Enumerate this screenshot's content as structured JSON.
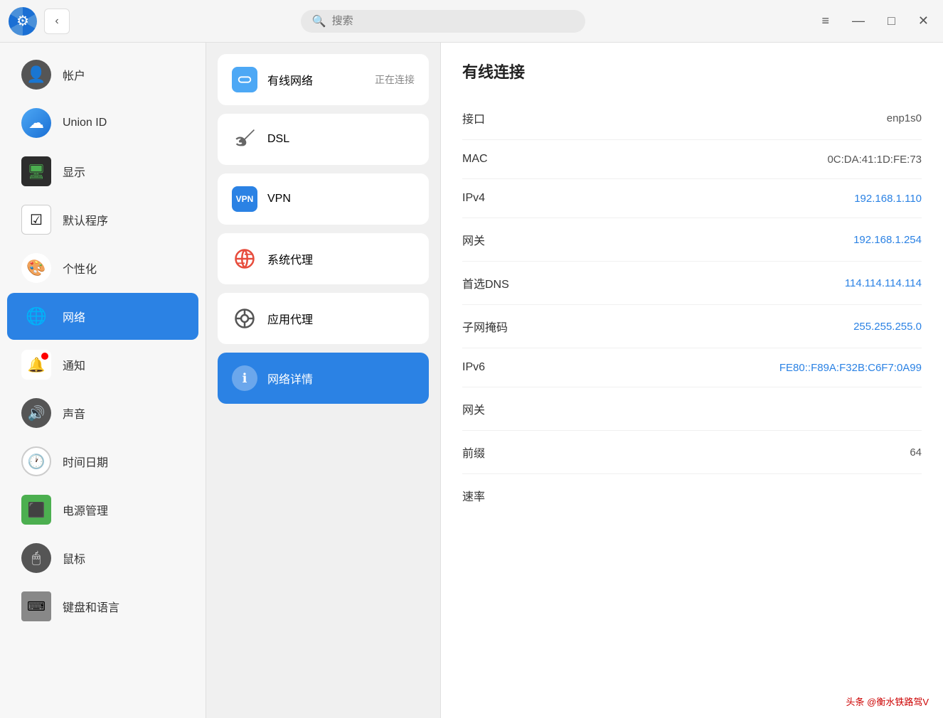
{
  "titlebar": {
    "back_label": "‹",
    "search_placeholder": "搜索",
    "menu_icon": "≡",
    "minimize_icon": "—",
    "restore_icon": "□",
    "close_icon": "✕"
  },
  "sidebar": {
    "items": [
      {
        "id": "account",
        "label": "帐户",
        "icon": "👤",
        "icon_type": "account"
      },
      {
        "id": "unionid",
        "label": "Union ID",
        "icon": "☁",
        "icon_type": "unionid"
      },
      {
        "id": "display",
        "label": "显示",
        "icon": "🖥",
        "icon_type": "display"
      },
      {
        "id": "default",
        "label": "默认程序",
        "icon": "☑",
        "icon_type": "default"
      },
      {
        "id": "personal",
        "label": "个性化",
        "icon": "🎨",
        "icon_type": "personal"
      },
      {
        "id": "network",
        "label": "网络",
        "icon": "🌐",
        "icon_type": "network",
        "active": true
      },
      {
        "id": "notify",
        "label": "通知",
        "icon": "🔔",
        "icon_type": "notify"
      },
      {
        "id": "sound",
        "label": "声音",
        "icon": "🔊",
        "icon_type": "sound"
      },
      {
        "id": "datetime",
        "label": "时间日期",
        "icon": "🕐",
        "icon_type": "datetime"
      },
      {
        "id": "power",
        "label": "电源管理",
        "icon": "⬛",
        "icon_type": "power"
      },
      {
        "id": "mouse",
        "label": "鼠标",
        "icon": "🖱",
        "icon_type": "mouse"
      },
      {
        "id": "keyboard",
        "label": "键盘和语言",
        "icon": "⌨",
        "icon_type": "keyboard"
      }
    ]
  },
  "middle_panel": {
    "items": [
      {
        "id": "wired",
        "label": "有线网络",
        "status": "正在连接",
        "icon_type": "wired"
      },
      {
        "id": "dsl",
        "label": "DSL",
        "status": "",
        "icon_type": "dsl"
      },
      {
        "id": "vpn",
        "label": "VPN",
        "status": "",
        "icon_type": "vpn"
      },
      {
        "id": "sysproxy",
        "label": "系统代理",
        "status": "",
        "icon_type": "sysproxy"
      },
      {
        "id": "appproxy",
        "label": "应用代理",
        "status": "",
        "icon_type": "appproxy"
      },
      {
        "id": "netdetail",
        "label": "网络详情",
        "status": "",
        "icon_type": "detail",
        "active": true
      }
    ]
  },
  "detail_panel": {
    "title": "有线连接",
    "rows": [
      {
        "key": "接口",
        "value": "enp1s0",
        "color": "black"
      },
      {
        "key": "MAC",
        "value": "0C:DA:41:1D:FE:73",
        "color": "black"
      },
      {
        "key": "IPv4",
        "value": "192.168.1.110",
        "color": "blue"
      },
      {
        "key": "网关",
        "value": "192.168.1.254",
        "color": "blue"
      },
      {
        "key": "首选DNS",
        "value": "114.114.114.114",
        "color": "blue"
      },
      {
        "key": "子网掩码",
        "value": "255.255.255.0",
        "color": "blue"
      },
      {
        "key": "IPv6",
        "value": "FE80::F89A:F32B:C6F7:0A99",
        "color": "blue"
      },
      {
        "key": "网关",
        "value": "",
        "color": "blue"
      },
      {
        "key": "前缀",
        "value": "64",
        "color": "black"
      },
      {
        "key": "速率",
        "value": "",
        "color": "blue"
      }
    ]
  },
  "watermark": {
    "text": "头条 @衡水铁路驾V"
  }
}
